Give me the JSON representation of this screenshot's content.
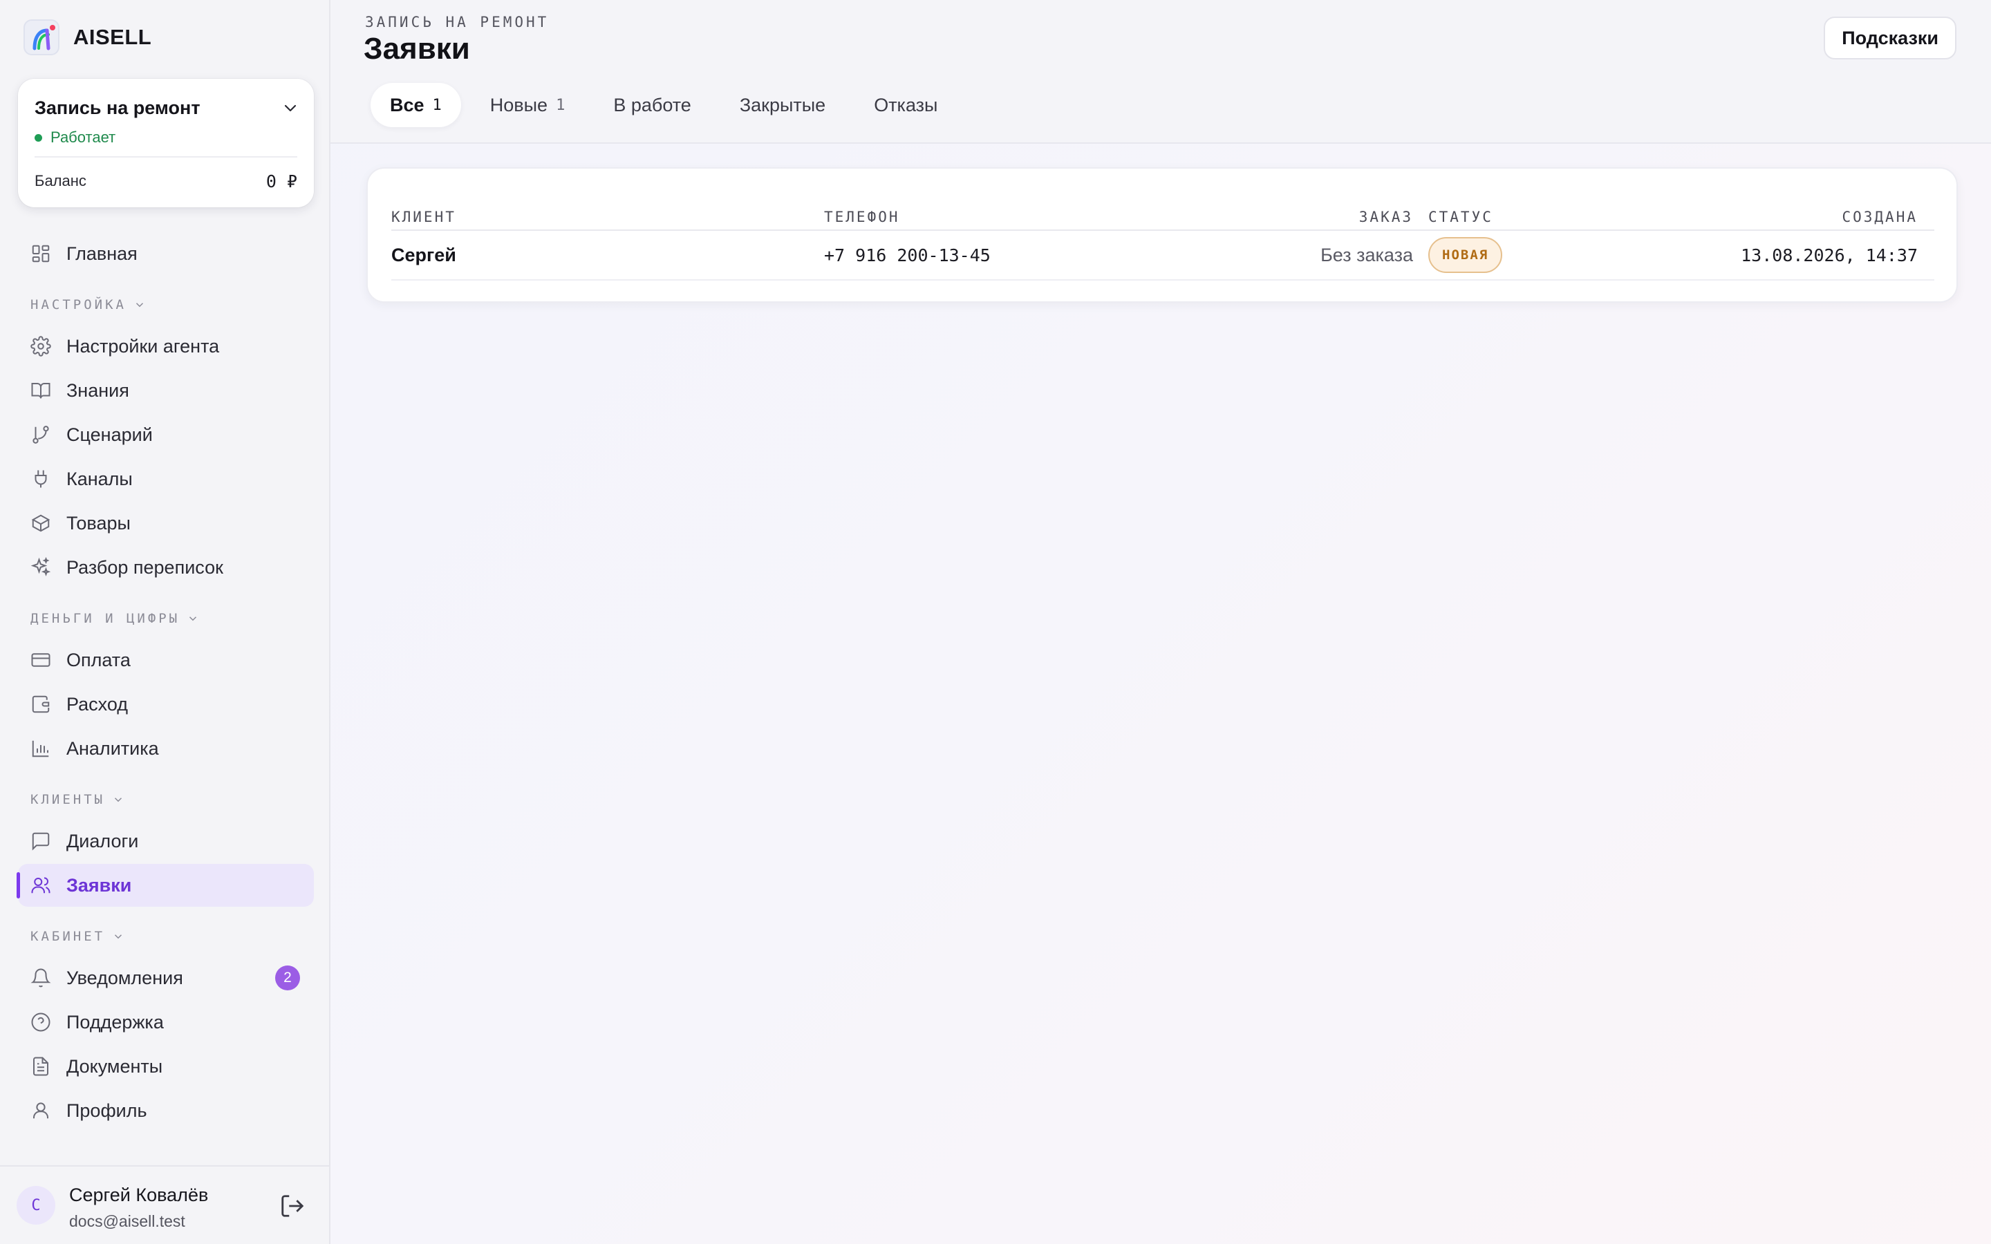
{
  "brand": {
    "name": "AISELL"
  },
  "agent": {
    "name": "Запись на ремонт",
    "status": "Работает",
    "balance_label": "Баланс",
    "balance_value": "0 ₽"
  },
  "nav": {
    "home": "Главная",
    "section_settings": "НАСТРОЙКА",
    "agent_settings": "Настройки агента",
    "knowledge": "Знания",
    "scenario": "Сценарий",
    "channels": "Каналы",
    "products": "Товары",
    "chat_review": "Разбор переписок",
    "section_money": "ДЕНЬГИ И ЦИФРЫ",
    "payment": "Оплата",
    "expense": "Расход",
    "analytics": "Аналитика",
    "section_clients": "КЛИЕНТЫ",
    "dialogs": "Диалоги",
    "requests": "Заявки",
    "section_cabinet": "КАБИНЕТ",
    "notifications": "Уведомления",
    "notifications_count": "2",
    "support": "Поддержка",
    "documents": "Документы",
    "profile": "Профиль"
  },
  "user": {
    "initial": "С",
    "name": "Сергей Ковалёв",
    "email": "docs@aisell.test"
  },
  "header": {
    "breadcrumb": "ЗАПИСЬ НА РЕМОНТ",
    "title": "Заявки",
    "hints_button": "Подсказки"
  },
  "tabs": [
    {
      "label": "Все",
      "count": "1",
      "active": true
    },
    {
      "label": "Новые",
      "count": "1",
      "active": false
    },
    {
      "label": "В работе",
      "count": "",
      "active": false
    },
    {
      "label": "Закрытые",
      "count": "",
      "active": false
    },
    {
      "label": "Отказы",
      "count": "",
      "active": false
    }
  ],
  "table": {
    "columns": {
      "client": "КЛИЕНТ",
      "phone": "ТЕЛЕФОН",
      "order": "ЗАКАЗ",
      "status": "СТАТУС",
      "created": "СОЗДАНА"
    },
    "rows": [
      {
        "client": "Сергей",
        "phone": "+7 916 200-13-45",
        "order": "Без заказа",
        "status": "НОВАЯ",
        "created": "13.08.2026, 14:37"
      }
    ]
  },
  "colors": {
    "accent": "#7c3aed",
    "active_bg": "#ebe6fb",
    "status_ok": "#1f9d55",
    "status_new_bg": "#fdf1e2",
    "status_new_text": "#b06b14"
  }
}
